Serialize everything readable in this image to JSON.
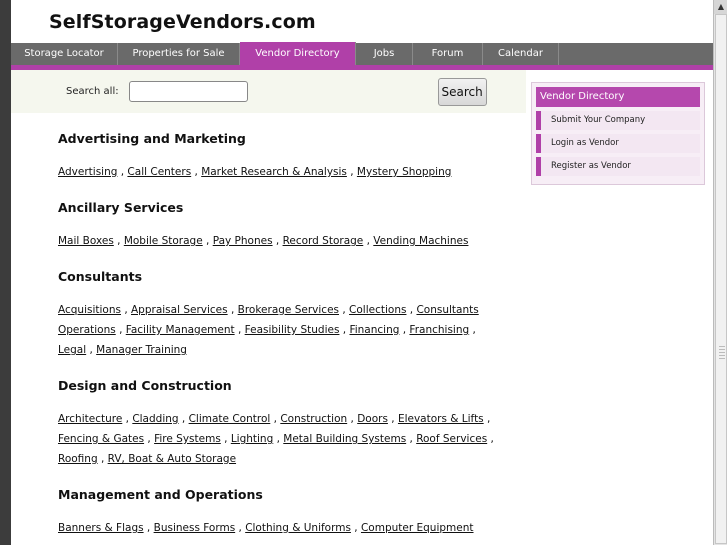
{
  "site": {
    "title": "SelfStorageVendors.com"
  },
  "nav": {
    "items": [
      {
        "label": "Storage Locator",
        "active": false
      },
      {
        "label": "Properties for Sale",
        "active": false
      },
      {
        "label": "Vendor Directory",
        "active": true
      },
      {
        "label": "Jobs",
        "active": false
      },
      {
        "label": "Forum",
        "active": false
      },
      {
        "label": "Calendar",
        "active": false
      }
    ]
  },
  "search": {
    "label": "Search all:",
    "value": "",
    "button": "Search"
  },
  "categories": [
    {
      "title": "Advertising and Marketing",
      "links": [
        "Advertising",
        "Call Centers",
        "Market Research & Analysis",
        "Mystery Shopping"
      ]
    },
    {
      "title": "Ancillary Services",
      "links": [
        "Mail Boxes",
        "Mobile Storage",
        "Pay Phones",
        "Record Storage",
        "Vending Machines"
      ]
    },
    {
      "title": "Consultants",
      "links": [
        "Acquisitions",
        "Appraisal Services",
        "Brokerage Services",
        "Collections",
        "Consultants Operations",
        "Facility Management",
        "Feasibility Studies",
        "Financing",
        "Franchising",
        "Legal",
        "Manager Training"
      ]
    },
    {
      "title": "Design and Construction",
      "links": [
        "Architecture",
        "Cladding",
        "Climate Control",
        "Construction",
        "Doors",
        "Elevators & Lifts",
        "Fencing & Gates",
        "Fire Systems",
        "Lighting",
        "Metal Building Systems",
        "Roof Services",
        "Roofing",
        "RV, Boat & Auto Storage"
      ]
    },
    {
      "title": "Management and Operations",
      "links": [
        "Banners & Flags",
        "Business Forms",
        "Clothing & Uniforms",
        "Computer Equipment"
      ]
    }
  ],
  "sidebar": {
    "title": "Vendor Directory",
    "items": [
      "Submit Your Company",
      "Login as Vendor",
      "Register as Vendor"
    ]
  },
  "colors": {
    "accent": "#b040a8",
    "nav_bg": "#6a6a6a",
    "search_bg": "#f5f7ee"
  }
}
